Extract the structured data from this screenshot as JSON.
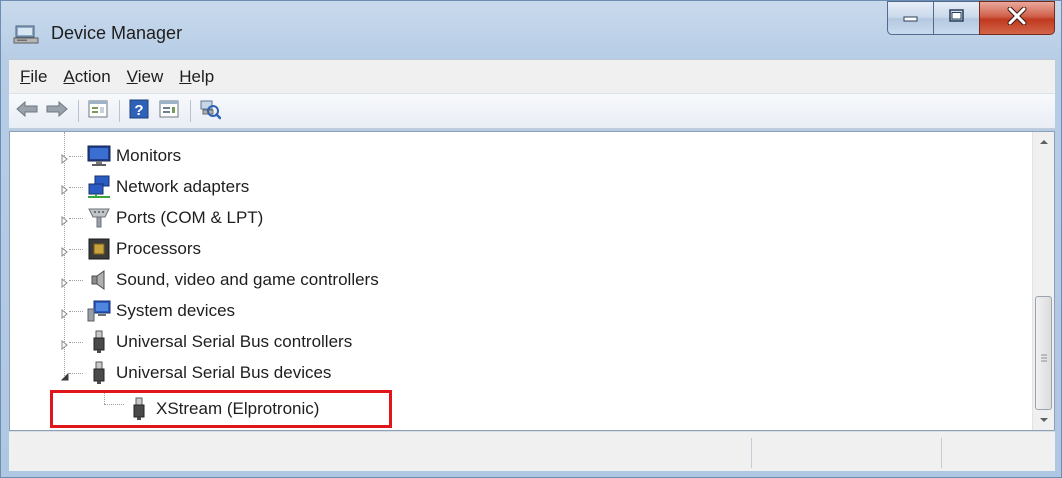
{
  "window": {
    "title": "Device Manager",
    "icons": [
      "device-manager-icon",
      "minimize-icon",
      "maximize-icon",
      "close-icon"
    ]
  },
  "menu": [
    {
      "label": "File",
      "accesskey": "F",
      "rest": "ile"
    },
    {
      "label": "Action",
      "accesskey": "A",
      "rest": "ction"
    },
    {
      "label": "View",
      "accesskey": "V",
      "rest": "iew"
    },
    {
      "label": "Help",
      "accesskey": "H",
      "rest": "elp"
    }
  ],
  "toolbar": {
    "buttons": [
      "back-arrow-icon",
      "forward-arrow-icon",
      "properties-icon",
      "help-icon",
      "show-hidden-icon",
      "scan-hardware-icon"
    ]
  },
  "tree": {
    "items": [
      {
        "label": "Monitors",
        "icon": "monitor-icon",
        "expander": "collapsed"
      },
      {
        "label": "Network adapters",
        "icon": "network-adapter-icon",
        "expander": "collapsed"
      },
      {
        "label": "Ports (COM & LPT)",
        "icon": "port-icon",
        "expander": "collapsed"
      },
      {
        "label": "Processors",
        "icon": "processor-icon",
        "expander": "collapsed"
      },
      {
        "label": "Sound, video and game controllers",
        "icon": "speaker-icon",
        "expander": "collapsed"
      },
      {
        "label": "System devices",
        "icon": "system-devices-icon",
        "expander": "collapsed"
      },
      {
        "label": "Universal Serial Bus controllers",
        "icon": "usb-plug-icon",
        "expander": "collapsed"
      },
      {
        "label": "Universal Serial Bus devices",
        "icon": "usb-plug-icon",
        "expander": "expanded"
      },
      {
        "label": "XStream (Elprotronic)",
        "icon": "usb-plug-icon",
        "expander": "none",
        "child": true,
        "highlighted": true
      }
    ]
  },
  "colors": {
    "highlight_border": "#e0161b",
    "close_button": "#c0391f"
  }
}
